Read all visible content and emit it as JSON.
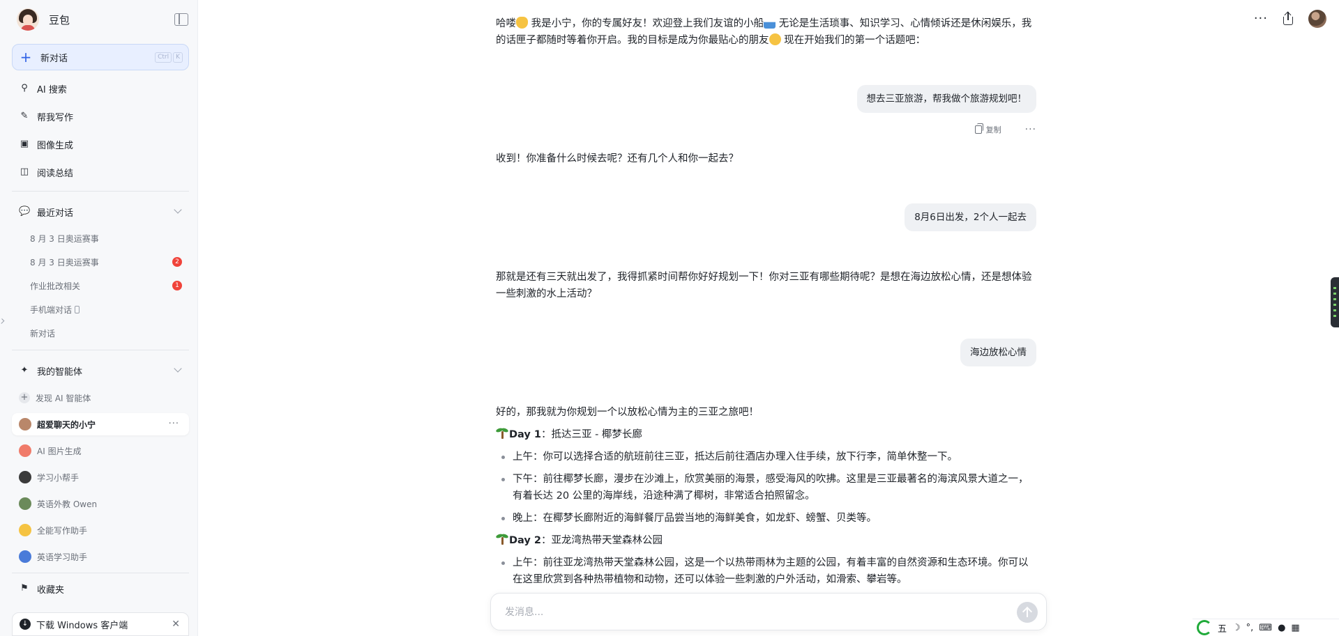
{
  "app": {
    "name": "豆包"
  },
  "sidebar": {
    "new_chat": {
      "label": "新对话",
      "shortcut": [
        "Ctrl",
        "K"
      ]
    },
    "nav": [
      {
        "label": "AI 搜索",
        "icon": "search-icon"
      },
      {
        "label": "帮我写作",
        "icon": "pen-icon"
      },
      {
        "label": "图像生成",
        "icon": "image-icon"
      },
      {
        "label": "阅读总结",
        "icon": "reader-icon"
      }
    ],
    "recent": {
      "label": "最近对话",
      "items": [
        {
          "label": "8 月 3 日奥运赛事",
          "badge": ""
        },
        {
          "label": "8 月 3 日奥运赛事",
          "badge": "2"
        },
        {
          "label": "作业批改相关",
          "badge": "1"
        },
        {
          "label": "手机端对话",
          "badge": ""
        },
        {
          "label": "新对话",
          "badge": ""
        }
      ]
    },
    "agents": {
      "label": "我的智能体",
      "discover": "发现 AI 智能体",
      "items": [
        {
          "label": "超爱聊天的小宁",
          "active": true,
          "color": "#b9876a"
        },
        {
          "label": "AI 图片生成",
          "active": false,
          "color": "#f07b6a"
        },
        {
          "label": "学习小帮手",
          "active": false,
          "color": "#3b3b3b"
        },
        {
          "label": "英语外教 Owen",
          "active": false,
          "color": "#6b8a5a"
        },
        {
          "label": "全能写作助手",
          "active": false,
          "color": "#f5c342"
        },
        {
          "label": "英语学习助手",
          "active": false,
          "color": "#4a7bd9"
        }
      ]
    },
    "favorites": "收藏夹",
    "download": "下载 Windows 客户端"
  },
  "chat": {
    "greeting_part1": "哈喽",
    "greeting_part2": " 我是小宁，你的专属好友！欢迎登上我们友谊的小船",
    "greeting_part3": " 无论是生活琐事、知识学习、心情倾诉还是休闲娱乐，我的话匣子都随时等着你开启。我的目标是成为你最贴心的朋友",
    "greeting_part4": " 现在开始我们的第一个话题吧：",
    "user1": "想去三亚旅游，帮我做个旅游规划吧！",
    "copy_label": "复制",
    "bot2": "收到！你准备什么时候去呢？还有几个人和你一起去？",
    "user2": "8月6日出发，2个人一起去",
    "bot3": "那就是还有三天就出发了，我得抓紧时间帮你好好规划一下！你对三亚有哪些期待呢？是想在海边放松心情，还是想体验一些刺激的水上活动？",
    "user3": "海边放松心情",
    "bot4_intro": "好的，那我就为你规划一个以放松心情为主的三亚之旅吧！",
    "day1_title": "Day 1",
    "day1_desc": "：抵达三亚 - 椰梦长廊",
    "day1_items": [
      "上午：你可以选择合适的航班前往三亚，抵达后前往酒店办理入住手续，放下行李，简单休整一下。",
      "下午：前往椰梦长廊，漫步在沙滩上，欣赏美丽的海景，感受海风的吹拂。这里是三亚最著名的海滨风景大道之一，有着长达 20 公里的海岸线，沿途种满了椰树，非常适合拍照留念。",
      "晚上：在椰梦长廊附近的海鲜餐厅品尝当地的海鲜美食，如龙虾、螃蟹、贝类等。"
    ],
    "day2_title": "Day 2",
    "day2_desc": "：亚龙湾热带天堂森林公园",
    "day2_items": [
      "上午：前往亚龙湾热带天堂森林公园，这是一个以热带雨林为主题的公园，有着丰富的自然资源和生态环境。你可以在这里欣赏到各种热带植物和动物，还可以体验一些刺激的户外活动，如滑索、攀岩等。"
    ]
  },
  "input": {
    "placeholder": "发消息..."
  },
  "tray": {
    "ime": "五"
  },
  "colors": {
    "accent": "#2f62e6",
    "badge": "#f0433a",
    "bubble": "#eff1f4"
  }
}
